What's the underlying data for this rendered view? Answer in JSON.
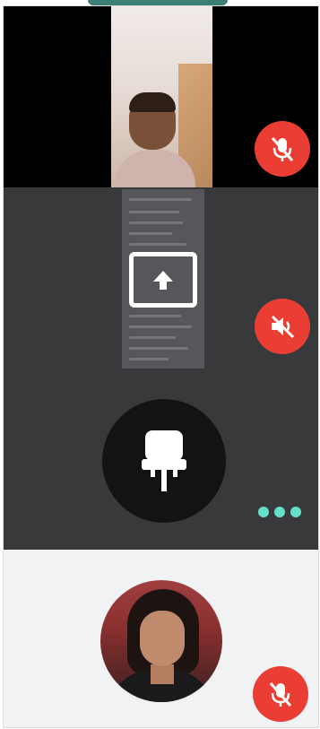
{
  "participants": [
    {
      "tile": "camera",
      "status_icons": [
        "mic-off-icon"
      ]
    },
    {
      "tile": "screen-share",
      "status_icons": [
        "speaker-off-icon"
      ],
      "share_icon": "upload-arrow-icon"
    },
    {
      "tile": "device",
      "avatar_icon": "power-plug-icon",
      "more_icon": "more-dots-icon"
    },
    {
      "tile": "profile",
      "status_icons": [
        "mic-off-icon"
      ]
    }
  ],
  "colors": {
    "accent": "#3b7f74",
    "mute_red": "#ea3e35",
    "tile_dark": "#38393b",
    "dots": "#67e0c9",
    "profile_bg": "#f0f2f4"
  }
}
